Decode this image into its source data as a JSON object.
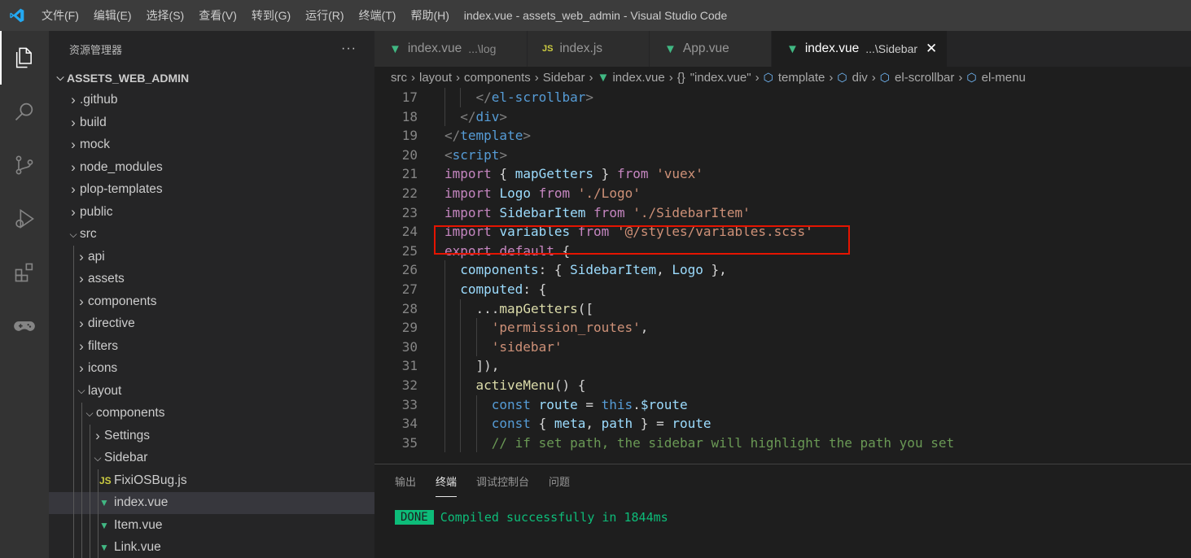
{
  "window": {
    "title": "index.vue - assets_web_admin - Visual Studio Code"
  },
  "menu": [
    "文件(F)",
    "编辑(E)",
    "选择(S)",
    "查看(V)",
    "转到(G)",
    "运行(R)",
    "终端(T)",
    "帮助(H)"
  ],
  "activity_bar": [
    "explorer-icon",
    "search-icon",
    "source-control-icon",
    "run-debug-icon",
    "extensions-icon",
    "gamepad-icon"
  ],
  "sidebar": {
    "header": "资源管理器",
    "more": "···",
    "root": "ASSETS_WEB_ADMIN",
    "items": [
      {
        "label": ".github",
        "depth": 1,
        "type": "folder",
        "open": false
      },
      {
        "label": "build",
        "depth": 1,
        "type": "folder",
        "open": false
      },
      {
        "label": "mock",
        "depth": 1,
        "type": "folder",
        "open": false
      },
      {
        "label": "node_modules",
        "depth": 1,
        "type": "folder",
        "open": false
      },
      {
        "label": "plop-templates",
        "depth": 1,
        "type": "folder",
        "open": false
      },
      {
        "label": "public",
        "depth": 1,
        "type": "folder",
        "open": false
      },
      {
        "label": "src",
        "depth": 1,
        "type": "folder",
        "open": true
      },
      {
        "label": "api",
        "depth": 2,
        "type": "folder",
        "open": false
      },
      {
        "label": "assets",
        "depth": 2,
        "type": "folder",
        "open": false
      },
      {
        "label": "components",
        "depth": 2,
        "type": "folder",
        "open": false
      },
      {
        "label": "directive",
        "depth": 2,
        "type": "folder",
        "open": false
      },
      {
        "label": "filters",
        "depth": 2,
        "type": "folder",
        "open": false
      },
      {
        "label": "icons",
        "depth": 2,
        "type": "folder",
        "open": false
      },
      {
        "label": "layout",
        "depth": 2,
        "type": "folder",
        "open": true
      },
      {
        "label": "components",
        "depth": 3,
        "type": "folder",
        "open": true
      },
      {
        "label": "Settings",
        "depth": 4,
        "type": "folder",
        "open": false
      },
      {
        "label": "Sidebar",
        "depth": 4,
        "type": "folder",
        "open": true
      },
      {
        "label": "FixiOSBug.js",
        "depth": 5,
        "type": "js",
        "icon": "JS"
      },
      {
        "label": "index.vue",
        "depth": 5,
        "type": "vue",
        "selected": true
      },
      {
        "label": "Item.vue",
        "depth": 5,
        "type": "vue"
      },
      {
        "label": "Link.vue",
        "depth": 5,
        "type": "vue"
      }
    ]
  },
  "tabs": [
    {
      "label": "index.vue",
      "desc": "...\\log",
      "icon": "vue",
      "active": false
    },
    {
      "label": "index.js",
      "desc": "",
      "icon": "js",
      "icon_text": "JS",
      "active": false
    },
    {
      "label": "App.vue",
      "desc": "",
      "icon": "vue",
      "active": false
    },
    {
      "label": "index.vue",
      "desc": "...\\Sidebar",
      "icon": "vue",
      "active": true,
      "close": "✕"
    }
  ],
  "breadcrumb": [
    {
      "label": "src"
    },
    {
      "label": "layout"
    },
    {
      "label": "components"
    },
    {
      "label": "Sidebar"
    },
    {
      "label": "index.vue",
      "icon": "vue"
    },
    {
      "label": "\"index.vue\"",
      "icon": "braces",
      "icon_text": "{}"
    },
    {
      "label": "template",
      "icon": "cube"
    },
    {
      "label": "div",
      "icon": "cube"
    },
    {
      "label": "el-scrollbar",
      "icon": "cube"
    },
    {
      "label": "el-menu",
      "icon": "cube"
    }
  ],
  "code": [
    {
      "n": "17",
      "indent": 2,
      "tokens": [
        [
          "brk",
          "</"
        ],
        [
          "tag",
          "el-scrollbar"
        ],
        [
          "brk",
          ">"
        ]
      ]
    },
    {
      "n": "18",
      "indent": 1,
      "tokens": [
        [
          "brk",
          "</"
        ],
        [
          "tag",
          "div"
        ],
        [
          "brk",
          ">"
        ]
      ]
    },
    {
      "n": "19",
      "indent": 0,
      "tokens": [
        [
          "brk",
          "</"
        ],
        [
          "tag",
          "template"
        ],
        [
          "brk",
          ">"
        ]
      ]
    },
    {
      "n": "20",
      "indent": 0,
      "tokens": [
        [
          "brk",
          "<"
        ],
        [
          "tag",
          "script"
        ],
        [
          "brk",
          ">"
        ]
      ]
    },
    {
      "n": "21",
      "indent": 0,
      "tokens": [
        [
          "kw",
          "import"
        ],
        [
          "plain",
          " { "
        ],
        [
          "var",
          "mapGetters"
        ],
        [
          "plain",
          " } "
        ],
        [
          "kw",
          "from"
        ],
        [
          "plain",
          " "
        ],
        [
          "str",
          "'vuex'"
        ]
      ]
    },
    {
      "n": "22",
      "indent": 0,
      "tokens": [
        [
          "kw",
          "import"
        ],
        [
          "plain",
          " "
        ],
        [
          "var",
          "Logo"
        ],
        [
          "plain",
          " "
        ],
        [
          "kw",
          "from"
        ],
        [
          "plain",
          " "
        ],
        [
          "str",
          "'./Logo'"
        ]
      ]
    },
    {
      "n": "23",
      "indent": 0,
      "tokens": [
        [
          "kw",
          "import"
        ],
        [
          "plain",
          " "
        ],
        [
          "var",
          "SidebarItem"
        ],
        [
          "plain",
          " "
        ],
        [
          "kw",
          "from"
        ],
        [
          "plain",
          " "
        ],
        [
          "str",
          "'./SidebarItem'"
        ]
      ]
    },
    {
      "n": "24",
      "indent": 0,
      "tokens": [
        [
          "kw",
          "import"
        ],
        [
          "plain",
          " "
        ],
        [
          "var",
          "variables"
        ],
        [
          "plain",
          " "
        ],
        [
          "kw",
          "from"
        ],
        [
          "plain",
          " "
        ],
        [
          "str",
          "'@/styles/variables.scss'"
        ]
      ]
    },
    {
      "n": "25",
      "indent": 0,
      "tokens": [
        [
          "kw",
          "export"
        ],
        [
          "plain",
          " "
        ],
        [
          "kw",
          "default"
        ],
        [
          "plain",
          " {"
        ]
      ]
    },
    {
      "n": "26",
      "indent": 1,
      "tokens": [
        [
          "var",
          "components"
        ],
        [
          "plain",
          ": { "
        ],
        [
          "var",
          "SidebarItem"
        ],
        [
          "plain",
          ", "
        ],
        [
          "var",
          "Logo"
        ],
        [
          "plain",
          " },"
        ]
      ]
    },
    {
      "n": "27",
      "indent": 1,
      "tokens": [
        [
          "var",
          "computed"
        ],
        [
          "plain",
          ": {"
        ]
      ]
    },
    {
      "n": "28",
      "indent": 2,
      "tokens": [
        [
          "plain",
          "..."
        ],
        [
          "fn",
          "mapGetters"
        ],
        [
          "plain",
          "(["
        ]
      ]
    },
    {
      "n": "29",
      "indent": 3,
      "tokens": [
        [
          "str",
          "'permission_routes'"
        ],
        [
          "plain",
          ","
        ]
      ]
    },
    {
      "n": "30",
      "indent": 3,
      "tokens": [
        [
          "str",
          "'sidebar'"
        ]
      ]
    },
    {
      "n": "31",
      "indent": 2,
      "tokens": [
        [
          "plain",
          "]),"
        ]
      ]
    },
    {
      "n": "32",
      "indent": 2,
      "tokens": [
        [
          "fn",
          "activeMenu"
        ],
        [
          "plain",
          "() {"
        ]
      ]
    },
    {
      "n": "33",
      "indent": 3,
      "tokens": [
        [
          "const",
          "const"
        ],
        [
          "plain",
          " "
        ],
        [
          "var",
          "route"
        ],
        [
          "plain",
          " = "
        ],
        [
          "const",
          "this"
        ],
        [
          "plain",
          "."
        ],
        [
          "var",
          "$route"
        ]
      ]
    },
    {
      "n": "34",
      "indent": 3,
      "tokens": [
        [
          "const",
          "const"
        ],
        [
          "plain",
          " { "
        ],
        [
          "var",
          "meta"
        ],
        [
          "plain",
          ", "
        ],
        [
          "var",
          "path"
        ],
        [
          "plain",
          " } = "
        ],
        [
          "var",
          "route"
        ]
      ]
    },
    {
      "n": "35",
      "indent": 3,
      "tokens": [
        [
          "com",
          "// if set path, the sidebar will highlight the path you set"
        ]
      ]
    }
  ],
  "panel": {
    "tabs": [
      "输出",
      "终端",
      "调试控制台",
      "问题"
    ],
    "active_tab": "终端",
    "badge": "DONE",
    "message": "Compiled successfully in 1844ms"
  },
  "colors": {
    "accent_green": "#0dbc79",
    "vue_green": "#41b883",
    "highlight_box": "#e51400"
  }
}
